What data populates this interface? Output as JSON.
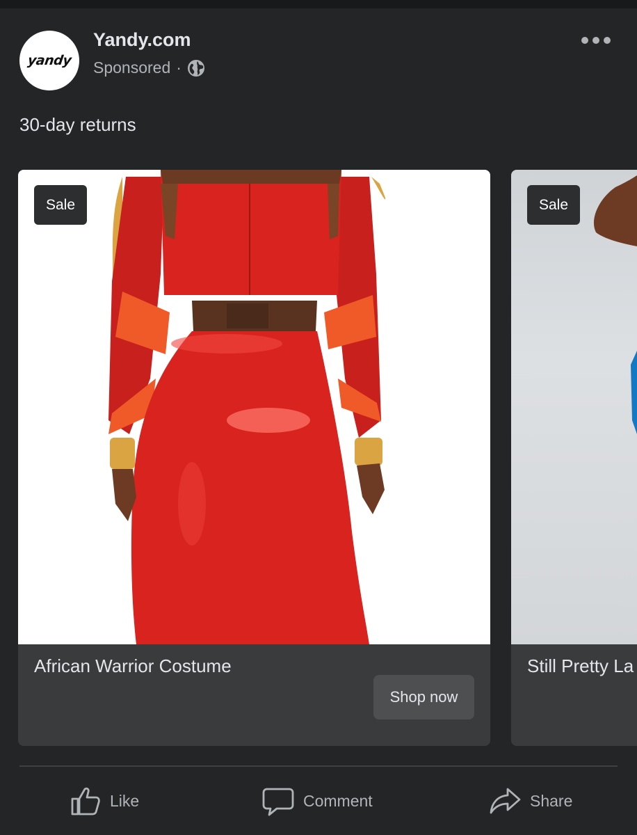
{
  "post": {
    "page_name": "Yandy.com",
    "avatar_text": "yandy",
    "sponsored_label": "Sponsored",
    "separator": "·",
    "caption": "30-day returns"
  },
  "icons": {
    "privacy": "globe-icon",
    "menu": "more-options-icon",
    "like": "thumbs-up-icon",
    "comment": "comment-bubble-icon",
    "share": "share-arrow-icon"
  },
  "carousel": {
    "cards": [
      {
        "badge": "Sale",
        "title": "African Warrior Costume",
        "cta": "Shop now"
      },
      {
        "badge": "Sale",
        "title": "Still Pretty La"
      }
    ]
  },
  "actions": {
    "like": "Like",
    "comment": "Comment",
    "share": "Share"
  },
  "colors": {
    "background": "#242526",
    "card": "#3a3b3c",
    "button": "#4e4f50",
    "text_primary": "#e4e6eb",
    "text_secondary": "#b0b3b8",
    "costume_red": "#d9231f"
  }
}
